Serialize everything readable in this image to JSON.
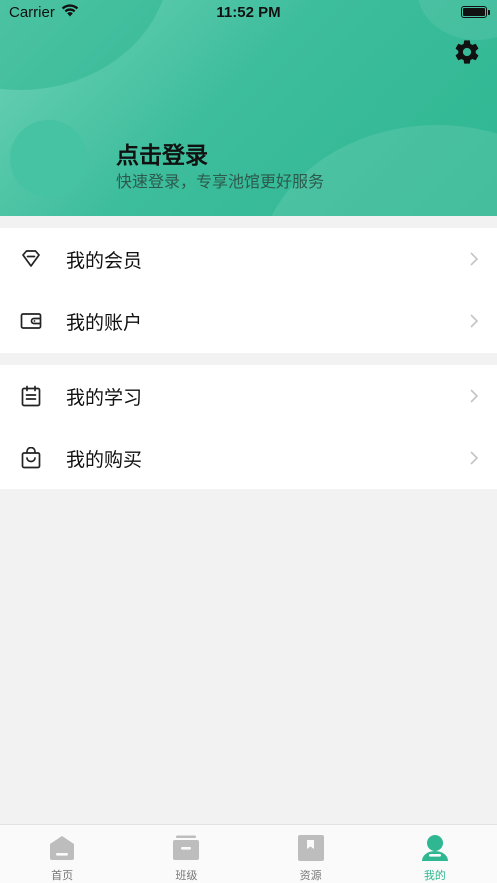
{
  "status_bar": {
    "carrier": "Carrier",
    "time": "11:52 PM"
  },
  "header": {
    "login_title": "点击登录",
    "login_subtitle": "快速登录，专享池馆更好服务"
  },
  "menu": {
    "group1": [
      {
        "label": "我的会员",
        "icon": "diamond-icon"
      },
      {
        "label": "我的账户",
        "icon": "wallet-icon"
      }
    ],
    "group2": [
      {
        "label": "我的学习",
        "icon": "calendar-icon"
      },
      {
        "label": "我的购买",
        "icon": "shopping-bag-icon"
      }
    ]
  },
  "tabbar": {
    "tabs": [
      {
        "label": "首页",
        "icon": "home-icon"
      },
      {
        "label": "班级",
        "icon": "class-icon"
      },
      {
        "label": "资源",
        "icon": "book-icon"
      },
      {
        "label": "我的",
        "icon": "profile-icon"
      }
    ],
    "active_index": 3
  },
  "colors": {
    "accent": "#2fb792",
    "header_light": "#6fd2b7",
    "inactive_icon": "#bdbdbd",
    "background": "#f2f2f2"
  }
}
